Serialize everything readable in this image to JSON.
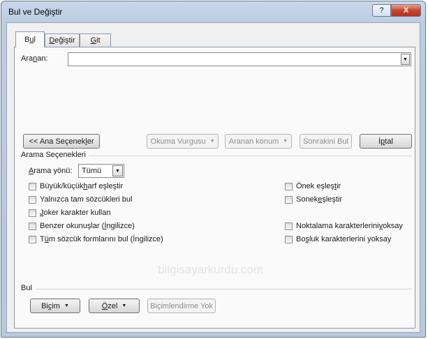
{
  "window": {
    "title": "Bul ve Değiştir",
    "help_label": "?",
    "close_label": "X"
  },
  "tabs": [
    {
      "pre": "B",
      "acc": "u",
      "post": "l"
    },
    {
      "pre": "",
      "acc": "D",
      "post": "eğiştir"
    },
    {
      "pre": "",
      "acc": "G",
      "post": "it"
    }
  ],
  "search": {
    "label_pre": "Ara",
    "label_acc": "n",
    "label_post": "an:",
    "value": ""
  },
  "buttons": {
    "less_options_pre": "<< Ana Seçenek",
    "less_options_acc": "l",
    "less_options_post": "er",
    "reading_highlight": "Okuma Vurgusu",
    "find_in": "Aranan konum",
    "find_next": "Sonrakini Bul",
    "cancel_pre": "İ",
    "cancel_acc": "p",
    "cancel_post": "tal"
  },
  "options": {
    "section_title": "Arama Seçenekleri",
    "direction_label_acc": "A",
    "direction_label_post": "rama yönü:",
    "direction_value": "Tümü",
    "left": [
      {
        "pre": "Büyük/küçük ",
        "acc": "h",
        "post": "arf eşleştir"
      },
      {
        "pre": "Yalnızca tam sözcükleri bul",
        "acc": "",
        "post": ""
      },
      {
        "pre": "",
        "acc": "J",
        "post": "oker karakter kullan"
      },
      {
        "pre": "Benzer okunuşlar (",
        "acc": "İ",
        "post": "ngilizce)"
      },
      {
        "pre": "T",
        "acc": "ü",
        "post": "m sözcük formlarını bul (İngilizce)"
      }
    ],
    "right": [
      {
        "pre": "Önek eşleş",
        "acc": "t",
        "post": "ir"
      },
      {
        "pre": "Sonek ",
        "acc": "e",
        "post": "şleştir"
      },
      {
        "pre": "Noktalama karakterlerini ",
        "acc": "y",
        "post": "oksay"
      },
      {
        "pre": "Bo",
        "acc": "ş",
        "post": "luk karakterlerini yoksay"
      }
    ]
  },
  "find_section": {
    "title": "Bul",
    "format_pre": "Bi",
    "format_acc": "ç",
    "format_post": "im",
    "special_acc": "Ö",
    "special_post": "zel",
    "no_formatting": "Biçimlendirme Yok"
  },
  "watermark": "bilgisayarkurdu.com"
}
